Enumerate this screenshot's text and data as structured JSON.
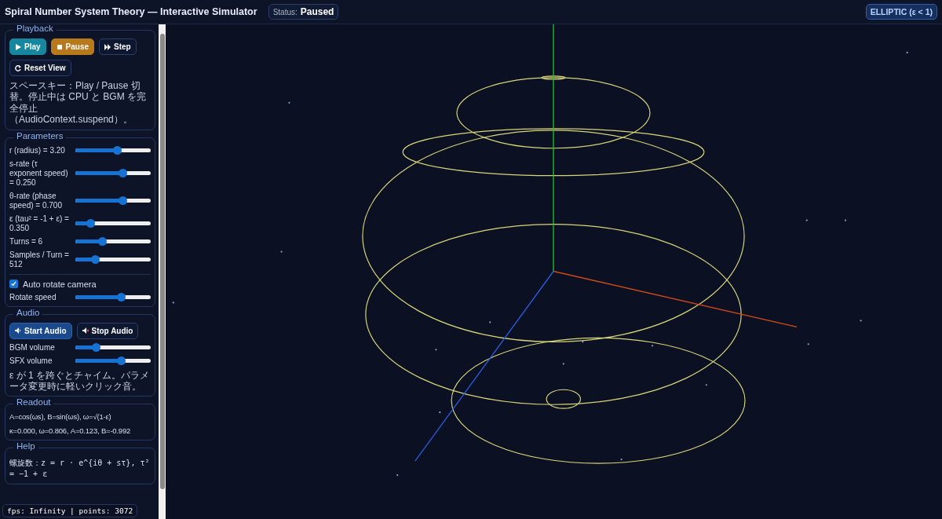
{
  "header": {
    "title": "Spiral Number System Theory — Interactive Simulator",
    "status_label": "Status:",
    "status_value": "Paused",
    "mode_badge": "ELLIPTIC (ε < 1)"
  },
  "panels": [
    {
      "kind": "playback",
      "title": "Playback",
      "buttons": [
        {
          "label": "Play",
          "kind": "teal"
        },
        {
          "label": "Pause",
          "kind": "amber"
        },
        {
          "label": "Step",
          "kind": "outline"
        },
        {
          "label": "Reset View",
          "kind": "outline"
        }
      ],
      "note": "スペースキー：Play / Pause 切替。停止中は CPU と BGM を完全停止（AudioContext.suspend）。"
    },
    {
      "kind": "parameters",
      "title": "Parameters",
      "sliders": [
        {
          "label": "r (radius) = 3.20",
          "level": 0.55
        },
        {
          "label": "s-rate (τ exponent speed) = 0.250",
          "level": 0.62
        },
        {
          "label": "θ-rate (phase speed) = 0.700",
          "level": 0.62
        },
        {
          "label": "ε (tau² = -1 + ε) = 0.350",
          "level": 0.2
        },
        {
          "label": "Turns = 6",
          "level": 0.35
        },
        {
          "label": "Samples / Turn = 512",
          "level": 0.26
        }
      ],
      "checkbox": {
        "label": "Auto rotate camera",
        "checked": true
      },
      "extra_sliders": [
        {
          "label": "Rotate speed",
          "level": 0.6
        }
      ]
    },
    {
      "kind": "audio",
      "title": "Audio",
      "buttons": [
        {
          "label": "Start Audio",
          "kind": "blue"
        },
        {
          "label": "Stop Audio",
          "kind": "outline"
        }
      ],
      "sliders": [
        {
          "label": "BGM volume",
          "level": 0.27
        },
        {
          "label": "SFX volume",
          "level": 0.6
        }
      ],
      "note": "ε が 1 を跨ぐとチャイム。パラメータ変更時に軽いクリック音。"
    },
    {
      "kind": "readout",
      "title": "Readout",
      "lines": [
        "A=cos(ωs), B=sin(ωs), ω=√(1-ε)",
        "κ=0.000, ω=0.806, A=0.123, B=-0.992"
      ]
    },
    {
      "kind": "help",
      "title": "Help",
      "lines": [
        "螺旋数：z = r · e^{iθ + sτ}, τ² = −1 + ε"
      ]
    }
  ],
  "fps_overlay": "fps: Infinity | points: 3072"
}
